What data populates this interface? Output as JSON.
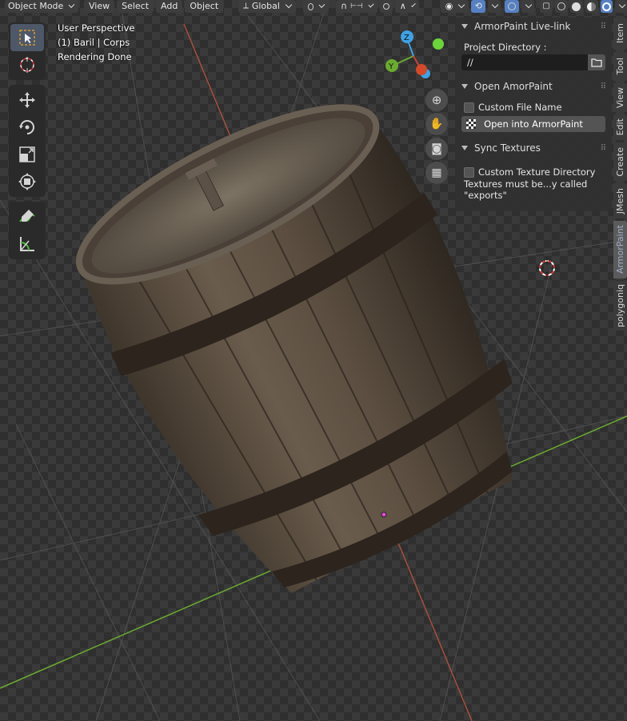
{
  "header": {
    "mode": "Object Mode",
    "menus": [
      "View",
      "Select",
      "Add",
      "Object"
    ],
    "transform_orientation": "Global"
  },
  "overlay": {
    "perspective": "User Perspective",
    "object": "(1) Baril | Corps",
    "status": "Rendering Done"
  },
  "gizmo": {
    "z": "Z",
    "y": "Y"
  },
  "panel": {
    "live_link": {
      "title": "ArmorPaint Live-link",
      "project_directory_label": "Project Directory :",
      "project_directory_value": "//"
    },
    "open": {
      "title": "Open AmorPaint",
      "custom_file_name": "Custom File Name",
      "open_button": "Open into ArmorPaint"
    },
    "sync": {
      "title": "Sync Textures",
      "custom_texture_dir": "Custom Texture Directory",
      "note": "Textures must be...y called \"exports\""
    }
  },
  "tabs": [
    "Item",
    "Tool",
    "View",
    "Edit",
    "Create",
    "JMesh",
    "ArmorPaint",
    "polygoniq"
  ],
  "active_tab": "ArmorPaint",
  "colors": {
    "accent": "#5680c2",
    "x_axis": "#c0453a",
    "y_axis": "#6bab31",
    "z_axis": "#3fa2e6"
  }
}
